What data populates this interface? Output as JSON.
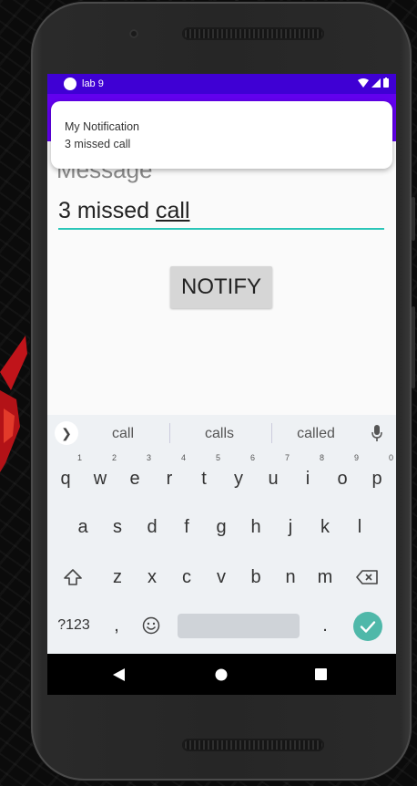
{
  "status_bar": {
    "app_label": "lab 9"
  },
  "notification": {
    "title": "My Notification",
    "text": "3 missed call"
  },
  "form": {
    "hint": "Message",
    "value_prefix": "3 missed ",
    "value_underlined": "call",
    "notify_button": "NOTIFY"
  },
  "keyboard": {
    "suggestions": [
      "call",
      "calls",
      "called"
    ],
    "row1": [
      {
        "key": "q",
        "num": "1"
      },
      {
        "key": "w",
        "num": "2"
      },
      {
        "key": "e",
        "num": "3"
      },
      {
        "key": "r",
        "num": "4"
      },
      {
        "key": "t",
        "num": "5"
      },
      {
        "key": "y",
        "num": "6"
      },
      {
        "key": "u",
        "num": "7"
      },
      {
        "key": "i",
        "num": "8"
      },
      {
        "key": "o",
        "num": "9"
      },
      {
        "key": "p",
        "num": "0"
      }
    ],
    "row2": [
      "a",
      "s",
      "d",
      "f",
      "g",
      "h",
      "j",
      "k",
      "l"
    ],
    "row3": [
      "z",
      "x",
      "c",
      "v",
      "b",
      "n",
      "m"
    ],
    "symbols_key": "?123",
    "comma_key": ",",
    "period_key": "."
  },
  "colors": {
    "status_bar": "#3f00d4",
    "app_bar": "#6200ee",
    "accent": "#2bc6b8",
    "enter_key": "#4fb8a9"
  }
}
